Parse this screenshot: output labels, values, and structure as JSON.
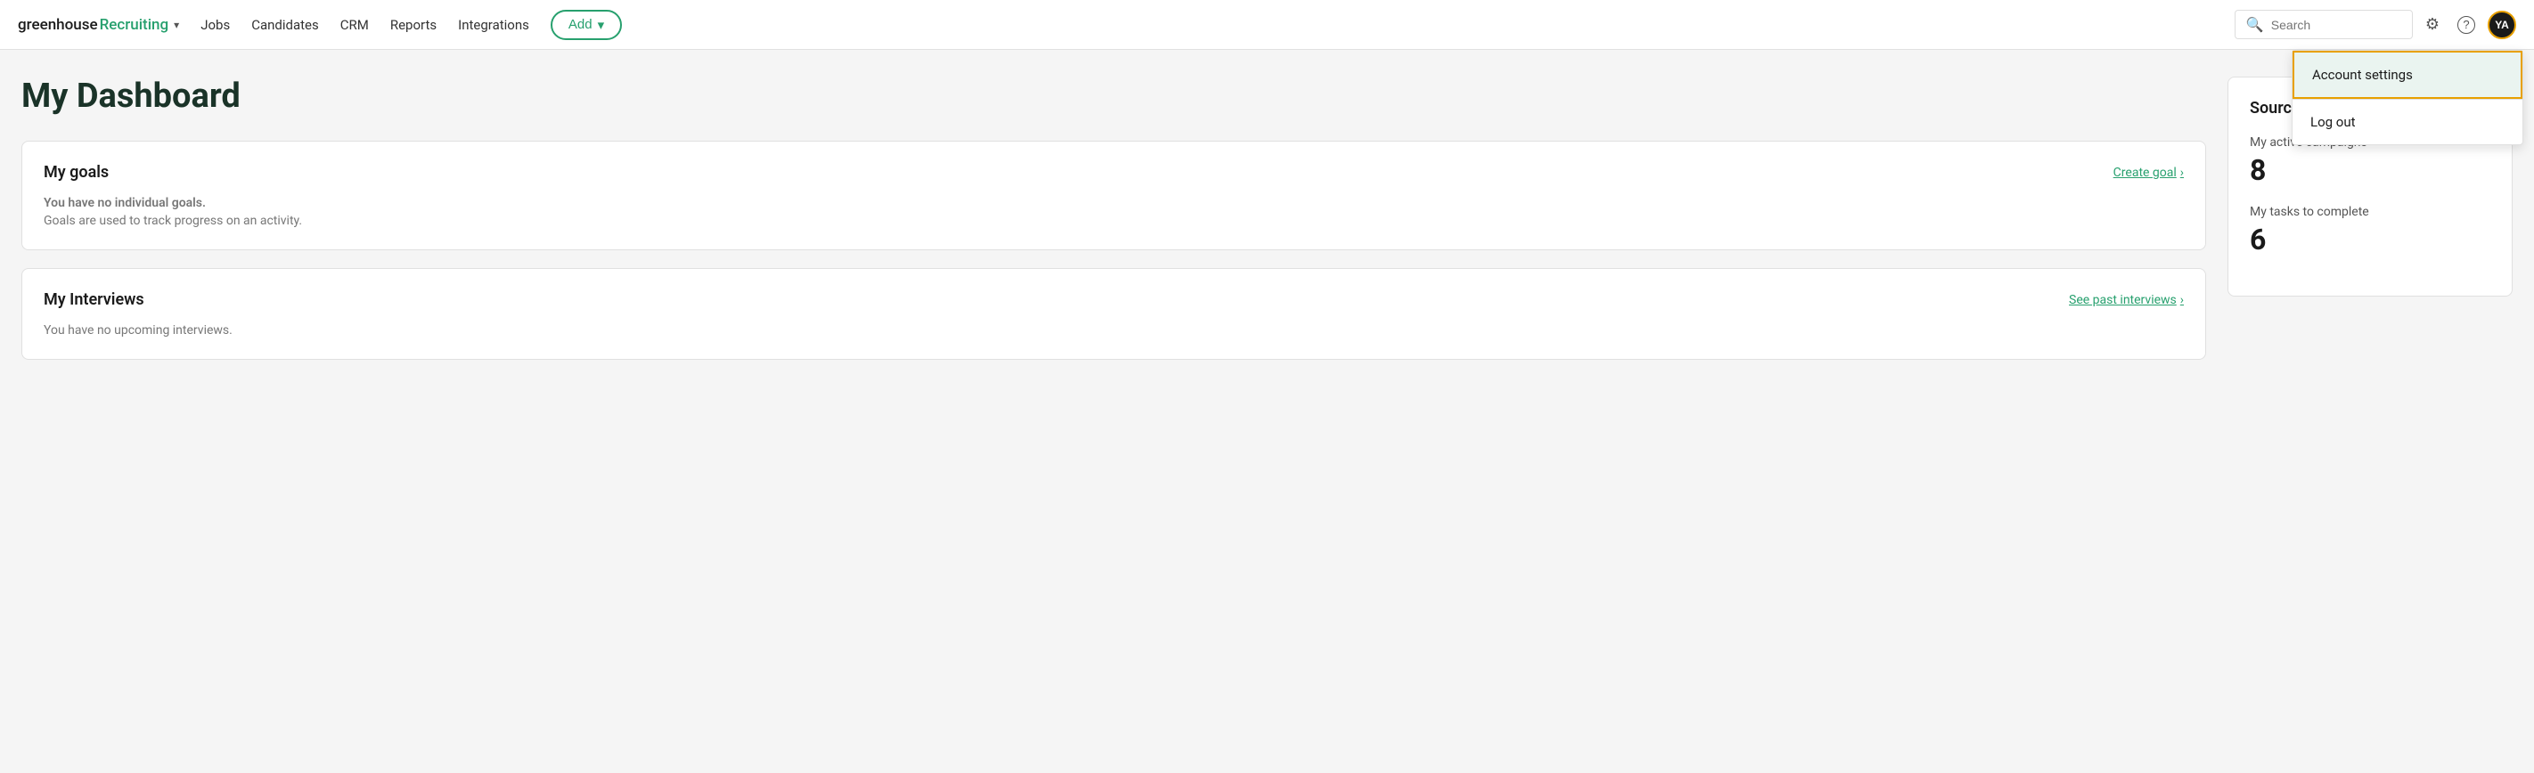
{
  "navbar": {
    "logo": {
      "greenhouse": "greenhouse",
      "recruiting": "Recruiting",
      "chevron": "▾"
    },
    "nav_links": [
      {
        "label": "Jobs",
        "id": "jobs"
      },
      {
        "label": "Candidates",
        "id": "candidates"
      },
      {
        "label": "CRM",
        "id": "crm"
      },
      {
        "label": "Reports",
        "id": "reports"
      },
      {
        "label": "Integrations",
        "id": "integrations"
      }
    ],
    "add_button": "Add",
    "add_chevron": "▾",
    "search_placeholder": "Search",
    "avatar_initials": "YA"
  },
  "dropdown": {
    "account_settings": "Account settings",
    "log_out": "Log out"
  },
  "main": {
    "page_title": "My Dashboard"
  },
  "goals_card": {
    "title": "My goals",
    "link": "Create goal",
    "link_chevron": "›",
    "subtitle": "You have no individual goals.",
    "body": "Goals are used to track progress on an activity."
  },
  "interviews_card": {
    "title": "My Interviews",
    "link": "See past interviews",
    "link_chevron": "›",
    "body": "You have no upcoming interviews."
  },
  "sourcing": {
    "title": "Sourcing Automation",
    "arrow": "›",
    "active_campaigns_label": "My active campaigns",
    "active_campaigns_value": "8",
    "tasks_label": "My tasks to complete",
    "tasks_value": "6"
  }
}
